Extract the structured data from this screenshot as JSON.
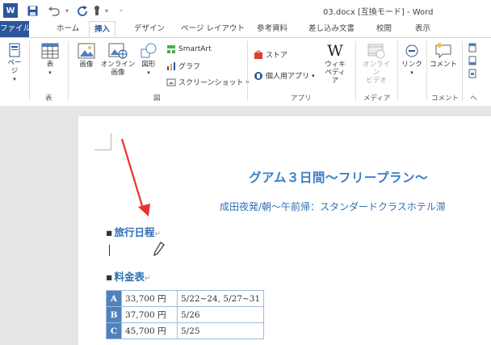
{
  "window": {
    "title": "03.docx [互換モード] - Word",
    "app_icon": "W"
  },
  "quick_access": {
    "save_icon": "save-icon",
    "undo_icon": "undo-icon",
    "redo_icon": "redo-icon",
    "touch_icon": "touch-mode-icon",
    "customize_icon": "customize-icon"
  },
  "tabs": [
    {
      "label": "ファイル"
    },
    {
      "label": "ホーム"
    },
    {
      "label": "挿入"
    },
    {
      "label": "デザイン"
    },
    {
      "label": "ページ レイアウト"
    },
    {
      "label": "参考資料"
    },
    {
      "label": "差し込み文書"
    },
    {
      "label": "校閲"
    },
    {
      "label": "表示"
    }
  ],
  "ribbon": {
    "page_btn": "ページ",
    "table_btn": "表",
    "image_btn": "画像",
    "online_image_btn_1": "オンライン",
    "online_image_btn_2": "画像",
    "shapes_btn": "図形",
    "smartart_btn": "SmartArt",
    "graph_btn": "グラフ",
    "screenshot_btn": "スクリーンショット",
    "store_btn": "ストア",
    "personal_apps_btn": "個人用アプリ",
    "wiki_btn_1": "ウィキ",
    "wiki_btn_2": "ペディア",
    "wiki_glyph": "W",
    "online_video_btn_1": "オンライン",
    "online_video_btn_2": "ビデオ",
    "link_btn": "リンク",
    "comment_btn": "コメント",
    "groups": {
      "table": "表",
      "figure": "図",
      "apps": "アプリ",
      "media": "メディア",
      "comment": "コメント",
      "header": "ヘ"
    }
  },
  "document": {
    "heading": "グアム３日間～フリープラン～",
    "subheading": "成田夜発/朝～午前帰：スタンダードクラスホテル滞",
    "section1": "旅行日程",
    "section2": "料金表",
    "bullet": "▪",
    "return_mark": "↵",
    "table_rows": [
      {
        "label": "A",
        "price": "33,700 円",
        "dates": "5/22~24, 5/27~31"
      },
      {
        "label": "B",
        "price": "37,700 円",
        "dates": "5/26"
      },
      {
        "label": "C",
        "price": "45,700 円",
        "dates": "5/25"
      }
    ]
  },
  "colors": {
    "brand": "#2b579a",
    "heading": "#3a7ec6",
    "table_header": "#4f81bd",
    "arrow": "#e8332c"
  }
}
